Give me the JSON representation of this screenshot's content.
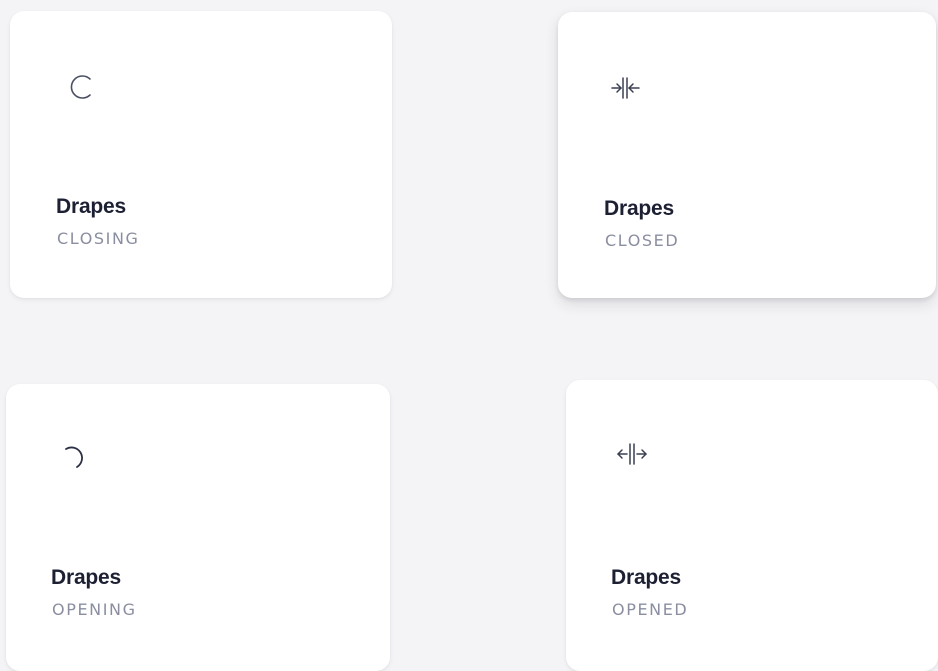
{
  "accent_color": "#1d2033",
  "status_color": "#8a8ea0",
  "cards": [
    {
      "title": "Drapes",
      "status": "CLOSING",
      "icon": "spinner-icon"
    },
    {
      "title": "Drapes",
      "status": "CLOSED",
      "icon": "drapes-closed-icon"
    },
    {
      "title": "Drapes",
      "status": "OPENING",
      "icon": "spinner-icon"
    },
    {
      "title": "Drapes",
      "status": "OPENED",
      "icon": "drapes-opened-icon"
    }
  ]
}
